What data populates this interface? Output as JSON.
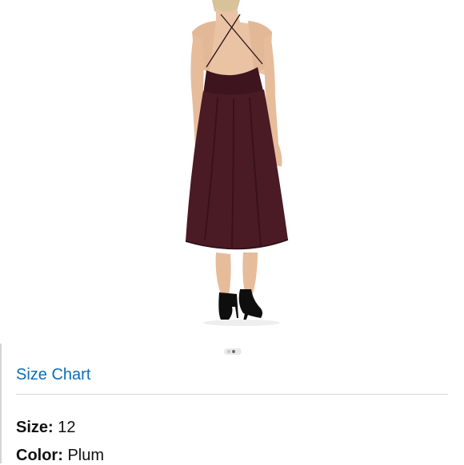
{
  "product": {
    "image_alt": "Plum backless chiffon midi dress with strappy cross back, shown from behind with black heels",
    "dress_color": "#4a1a25",
    "image_dot_count": 2,
    "active_image_index": 1
  },
  "links": {
    "size_chart": "Size Chart"
  },
  "attributes": {
    "size_label": "Size:",
    "size_value": "12",
    "color_label": "Color:",
    "color_value": "Plum"
  },
  "colors": {
    "link": "#0b6db7",
    "text": "#111111",
    "divider": "#d8d8d8"
  }
}
